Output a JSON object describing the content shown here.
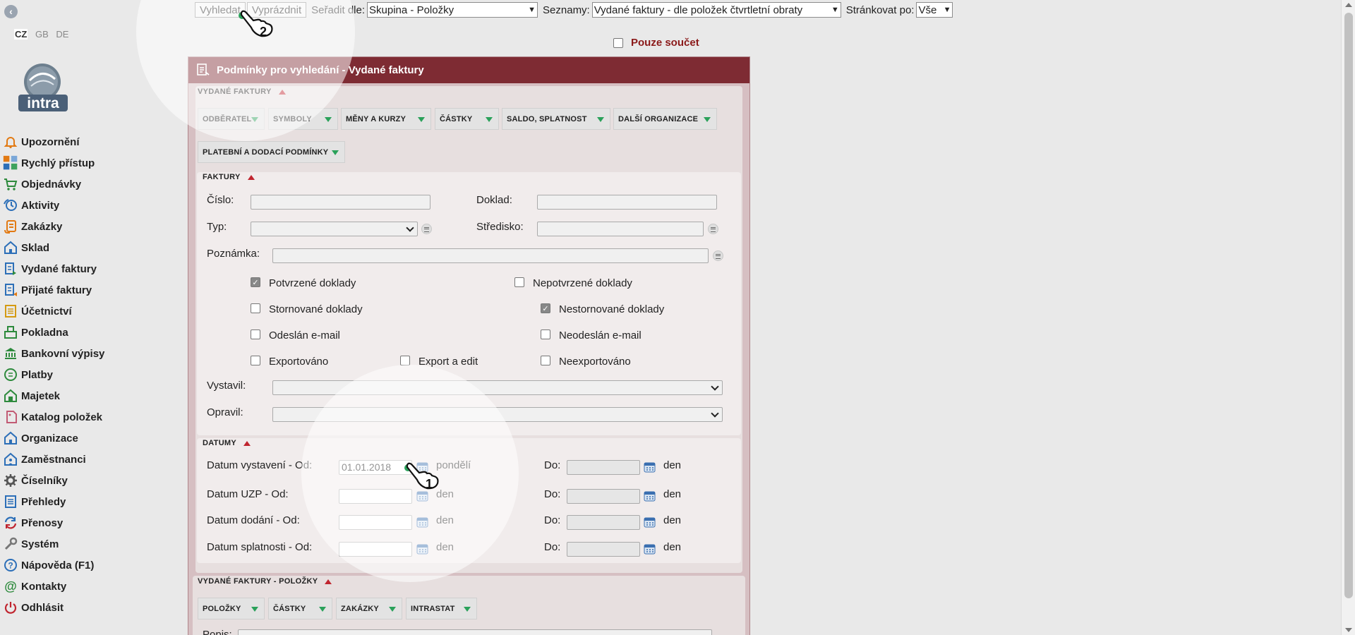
{
  "sidebar": {
    "languages": [
      "CZ",
      "GB",
      "DE"
    ],
    "logo_text": "intra",
    "items": [
      {
        "label": "Upozornění",
        "icon": "bell-icon"
      },
      {
        "label": "Rychlý přístup",
        "icon": "quick-access-icon"
      },
      {
        "label": "Objednávky",
        "icon": "cart-icon"
      },
      {
        "label": "Aktivity",
        "icon": "activity-icon"
      },
      {
        "label": "Zakázky",
        "icon": "order-icon"
      },
      {
        "label": "Sklad",
        "icon": "warehouse-icon"
      },
      {
        "label": "Vydané faktury",
        "icon": "issued-invoice-icon"
      },
      {
        "label": "Přijaté faktury",
        "icon": "received-invoice-icon"
      },
      {
        "label": "Účetnictví",
        "icon": "accounting-icon"
      },
      {
        "label": "Pokladna",
        "icon": "cashdesk-icon"
      },
      {
        "label": "Bankovní výpisy",
        "icon": "bank-icon"
      },
      {
        "label": "Platby",
        "icon": "payments-icon"
      },
      {
        "label": "Majetek",
        "icon": "property-icon"
      },
      {
        "label": "Katalog položek",
        "icon": "catalog-icon"
      },
      {
        "label": "Organizace",
        "icon": "organization-icon"
      },
      {
        "label": "Zaměstnanci",
        "icon": "employees-icon"
      },
      {
        "label": "Číselníky",
        "icon": "gear-icon"
      },
      {
        "label": "Přehledy",
        "icon": "overview-icon"
      },
      {
        "label": "Přenosy",
        "icon": "transfer-icon"
      },
      {
        "label": "Systém",
        "icon": "wrench-icon"
      },
      {
        "label": "Nápověda (F1)",
        "icon": "help-icon"
      },
      {
        "label": "Kontakty",
        "icon": "at-icon"
      },
      {
        "label": "Odhlásit",
        "icon": "power-icon"
      }
    ]
  },
  "toolbar": {
    "search_label": "Vyhledat",
    "clear_label": "Vyprázdnit",
    "sort_label": "Seřadit dle:",
    "sort_value": "Skupina - Položky",
    "lists_label": "Seznamy:",
    "lists_value": "Vydané faktury - dle položek čtvrtletní obraty",
    "paging_label": "Stránkovat po:",
    "paging_value": "Vše",
    "only_sum_label": "Pouze součet"
  },
  "panel": {
    "title": "Podmínky pro vyhledání - Vydané faktury",
    "section_invoices": "VYDANÉ FAKTURY",
    "tabs": [
      "ODBĚRATEL",
      "SYMBOLY",
      "MĚNY A KURZY",
      "ČÁSTKY",
      "SALDO, SPLATNOST",
      "DALŠÍ ORGANIZACE",
      "PLATEBNÍ A DODACÍ PODMÍNKY"
    ],
    "faktury": {
      "title": "FAKTURY",
      "cislo_label": "Číslo:",
      "doklad_label": "Doklad:",
      "typ_label": "Typ:",
      "stredisko_label": "Středisko:",
      "poznamka_label": "Poznámka:",
      "checkboxes": [
        {
          "label": "Potvrzené doklady",
          "checked": true
        },
        {
          "label": "Nepotvrzené doklady",
          "checked": false
        },
        {
          "label": "Stornované doklady",
          "checked": false
        },
        {
          "label": "Nestornované doklady",
          "checked": true
        },
        {
          "label": "Odeslán e-mail",
          "checked": false
        },
        {
          "label": "Neodeslán e-mail",
          "checked": false
        },
        {
          "label": "Exportováno",
          "checked": false
        },
        {
          "label": "Export a edit",
          "checked": false
        },
        {
          "label": "Neexportováno",
          "checked": false
        }
      ],
      "vystavil_label": "Vystavil:",
      "opravil_label": "Opravil:"
    },
    "datumy": {
      "title": "DATUMY",
      "to_label": "Do:",
      "rows": [
        {
          "label": "Datum vystavení - Od:",
          "from": "01.01.2018",
          "from_day": "pondělí",
          "to_day": "den"
        },
        {
          "label": "Datum UZP - Od:",
          "from": "",
          "from_day": "den",
          "to_day": "den"
        },
        {
          "label": "Datum dodání - Od:",
          "from": "",
          "from_day": "den",
          "to_day": "den"
        },
        {
          "label": "Datum splatnosti - Od:",
          "from": "",
          "from_day": "den",
          "to_day": "den"
        }
      ]
    },
    "section_items": "VYDANÉ FAKTURY - POLOŽKY",
    "item_tabs": [
      "POLOŽKY",
      "ČÁSTKY",
      "ZAKÁZKY",
      "INTRASTAT"
    ],
    "bottom_label": "Popis:"
  },
  "callouts": {
    "step1": "1",
    "step2": "2"
  }
}
